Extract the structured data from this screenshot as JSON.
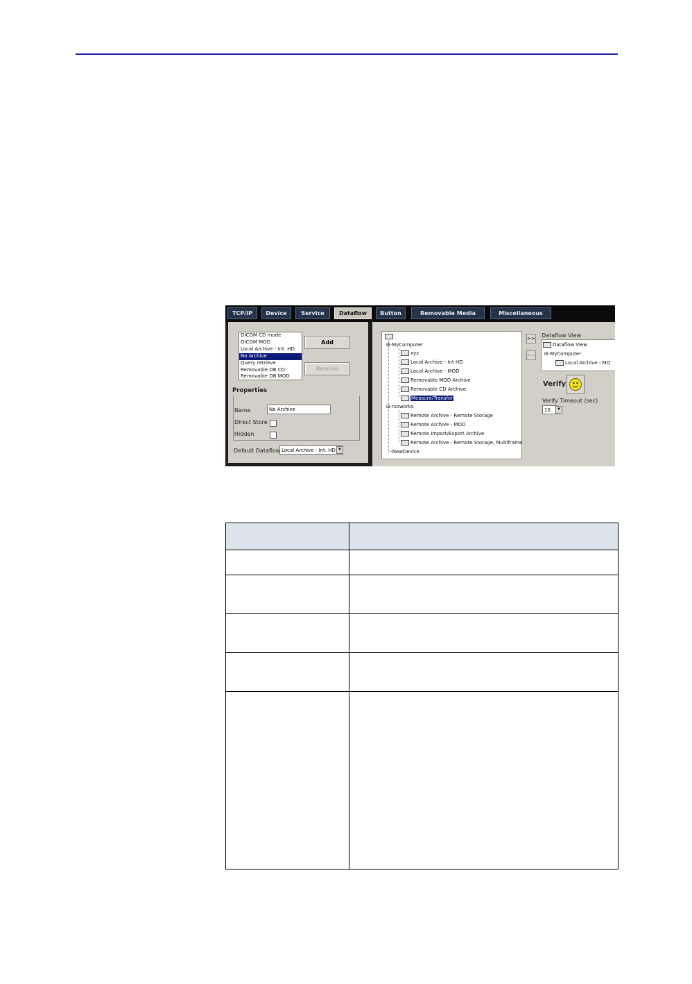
{
  "screenshot": {
    "tabs": [
      "TCP/IP",
      "Device",
      "Service",
      "Dataflow",
      "Button",
      "Removable Media",
      "Miscellaneous"
    ],
    "active_tab": "Dataflow",
    "dataflow_list": [
      "DICOM CD mode",
      "DICOM MOD",
      "Local Archive - Int. HD",
      "No Archive",
      "Query retrieve",
      "Removable DB CD",
      "Removable DB MOD"
    ],
    "selected_dataflow": "No Archive",
    "add_label": "Add",
    "remove_label": "Remove",
    "properties_label": "Properties",
    "name_label": "Name",
    "name_value": "No Archive",
    "direct_store_label": "Direct Store",
    "hidden_label": "Hidden",
    "default_dataflow_label": "Default Dataflow",
    "default_dataflow_value": "Local Archive - Int. HD",
    "tree": {
      "mycomputer": "MyComputer",
      "mycomputer_items": [
        "xyz",
        "Local Archive - Int HD",
        "Local Archive - MOD",
        "Removable MOD Archive",
        "Removable CD Archive",
        "Measure/Transfer"
      ],
      "selected_item": "Measure/Transfer",
      "network": "rsoworks",
      "network_items": [
        "Remote Archive - Remote Storage",
        "Remote Archive - MOD",
        "Remote Import/Export Archive",
        "Remote Archive - Remote Storage, Multiframe"
      ],
      "new_device": "NewDevice"
    },
    "move_right_label": ">>",
    "move_left_label": "<<",
    "dataflow_view_label": "Dataflow View",
    "dataflow_view_tree": [
      "Dataflow View",
      "MyComputer",
      "Local Archive - MO"
    ],
    "verify_label": "Verify",
    "verify_timeout_label": "Verify Timeout (sec)",
    "verify_timeout_value": "10"
  },
  "table": {
    "header": [
      "",
      ""
    ],
    "rows": [
      [
        "",
        ""
      ],
      [
        "",
        ""
      ],
      [
        "",
        ""
      ],
      [
        "",
        ""
      ],
      [
        "",
        ""
      ]
    ]
  }
}
